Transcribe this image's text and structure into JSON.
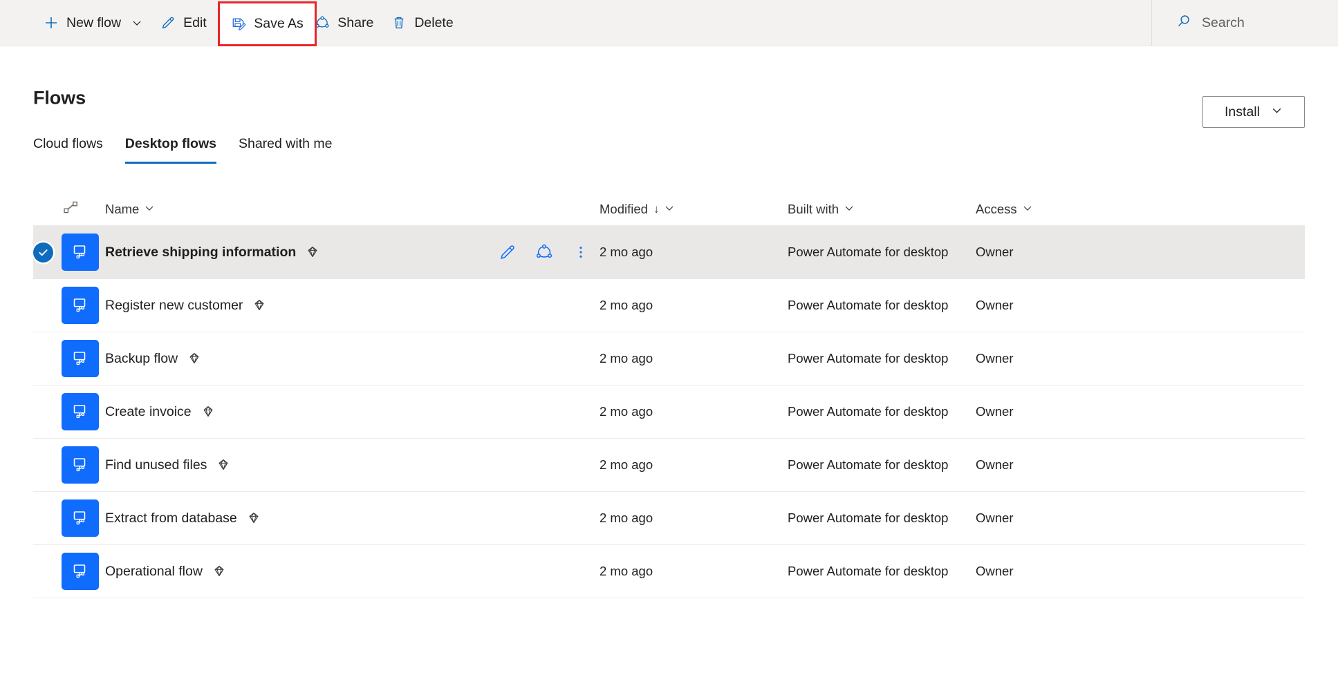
{
  "commandbar": {
    "buttons": [
      {
        "label": "New flow",
        "icon": "plus-icon",
        "has_chevron": true
      },
      {
        "label": "Edit",
        "icon": "pencil-icon",
        "has_chevron": false
      },
      {
        "label": "Save As",
        "icon": "save-as-icon",
        "has_chevron": false,
        "highlighted": true
      },
      {
        "label": "Share",
        "icon": "share-icon",
        "has_chevron": false
      },
      {
        "label": "Delete",
        "icon": "trash-icon",
        "has_chevron": false
      }
    ],
    "search": {
      "placeholder": "Search",
      "icon": "search-icon"
    },
    "highlight_color": "#e8252a"
  },
  "header": {
    "title": "Flows",
    "install_label": "Install",
    "install_icon": "chevron-down-icon"
  },
  "tabs": [
    {
      "label": "Cloud flows",
      "active": false
    },
    {
      "label": "Desktop flows",
      "active": true
    },
    {
      "label": "Shared with me",
      "active": false
    }
  ],
  "table": {
    "columns": {
      "icon_header": "flow-connector-icon",
      "name": "Name",
      "modified": "Modified",
      "modified_sort": "↓",
      "built_with": "Built with",
      "access": "Access",
      "chevron": "∨"
    },
    "rows": [
      {
        "name": "Retrieve shipping information",
        "premium": true,
        "modified": "2 mo ago",
        "built_with": "Power Automate for desktop",
        "access": "Owner",
        "selected": true,
        "actions": [
          "edit-icon",
          "share-icon",
          "more-icon"
        ]
      },
      {
        "name": "Register new customer",
        "premium": true,
        "modified": "2 mo ago",
        "built_with": "Power Automate for desktop",
        "access": "Owner",
        "selected": false,
        "actions": []
      },
      {
        "name": "Backup flow",
        "premium": true,
        "modified": "2 mo ago",
        "built_with": "Power Automate for desktop",
        "access": "Owner",
        "selected": false,
        "actions": []
      },
      {
        "name": "Create invoice",
        "premium": true,
        "modified": "2 mo ago",
        "built_with": "Power Automate for desktop",
        "access": "Owner",
        "selected": false,
        "actions": []
      },
      {
        "name": "Find unused files",
        "premium": true,
        "modified": "2 mo ago",
        "built_with": "Power Automate for desktop",
        "access": "Owner",
        "selected": false,
        "actions": []
      },
      {
        "name": "Extract from database",
        "premium": true,
        "modified": "2 mo ago",
        "built_with": "Power Automate for desktop",
        "access": "Owner",
        "selected": false,
        "actions": []
      },
      {
        "name": "Operational flow",
        "premium": true,
        "modified": "2 mo ago",
        "built_with": "Power Automate for desktop",
        "access": "Owner",
        "selected": false,
        "actions": []
      }
    ]
  },
  "colors": {
    "accent": "#0f6cbd",
    "tile_blue": "#0f6cfd",
    "commandbar_bg": "#f3f2f1",
    "selected_row": "#e9e8e7",
    "highlight_red": "#e8252a"
  }
}
